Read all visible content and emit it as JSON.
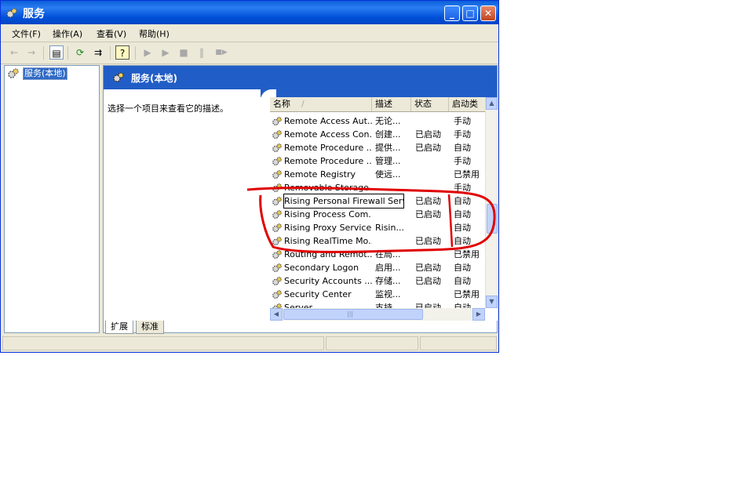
{
  "window": {
    "title": "服务",
    "buttons": {
      "minimize": "_",
      "maximize": "□",
      "close": "✕"
    }
  },
  "menu": [
    "文件(F)",
    "操作(A)",
    "查看(V)",
    "帮助(H)"
  ],
  "toolbar": {
    "back": "←",
    "forward": "→",
    "show_hide_tree": "▤",
    "refresh": "⟳",
    "export": "⇉",
    "help": "?",
    "start": "▶",
    "start2": "▶",
    "stop": "■",
    "pause": "‖",
    "restart": "■▶"
  },
  "tree": {
    "root_label": "服务(本地)"
  },
  "panel": {
    "title": "服务(本地)",
    "description": "选择一个项目来查看它的描述。"
  },
  "list": {
    "columns": [
      "名称",
      "描述",
      "状态",
      "启动类"
    ],
    "sort_indicator": "/",
    "rows": [
      {
        "name": "Remote Access Aut...",
        "desc": "无论...",
        "status": "",
        "startup": "手动"
      },
      {
        "name": "Remote Access Con...",
        "desc": "创建...",
        "status": "已启动",
        "startup": "手动"
      },
      {
        "name": "Remote Procedure ...",
        "desc": "提供...",
        "status": "已启动",
        "startup": "自动"
      },
      {
        "name": "Remote Procedure ...",
        "desc": "管理...",
        "status": "",
        "startup": "手动"
      },
      {
        "name": "Remote Registry",
        "desc": "使远...",
        "status": "",
        "startup": "已禁用"
      },
      {
        "name": "Removable Storage",
        "desc": "",
        "status": "",
        "startup": "手动"
      },
      {
        "name": "Rising Personal Firewall Service",
        "desc": "",
        "status": "已启动",
        "startup": "自动"
      },
      {
        "name": "Rising Process Com...",
        "desc": "",
        "status": "已启动",
        "startup": "自动"
      },
      {
        "name": "Rising Proxy  Service",
        "desc": "Risin...",
        "status": "",
        "startup": "自动"
      },
      {
        "name": "Rising RealTime Mo...",
        "desc": "",
        "status": "已启动",
        "startup": "自动"
      },
      {
        "name": "Routing and Remot...",
        "desc": "在局...",
        "status": "",
        "startup": "已禁用"
      },
      {
        "name": "Secondary Logon",
        "desc": "启用...",
        "status": "已启动",
        "startup": "自动"
      },
      {
        "name": "Security Accounts ...",
        "desc": "存储...",
        "status": "已启动",
        "startup": "自动"
      },
      {
        "name": "Security Center",
        "desc": "监视...",
        "status": "",
        "startup": "已禁用"
      },
      {
        "name": "Server",
        "desc": "支持...",
        "status": "已启动",
        "startup": "自动"
      }
    ],
    "selected_row": 6,
    "scroll": {
      "up": "▲",
      "down": "▼",
      "left": "◀",
      "right": "▶",
      "grip": "|||"
    }
  },
  "tabs": [
    "扩展",
    "标准"
  ],
  "colors": {
    "title_bar": "#0a5fd9",
    "panel_banner": "#215dc6",
    "selection": "#316ac5",
    "annotation": "#e00000"
  }
}
